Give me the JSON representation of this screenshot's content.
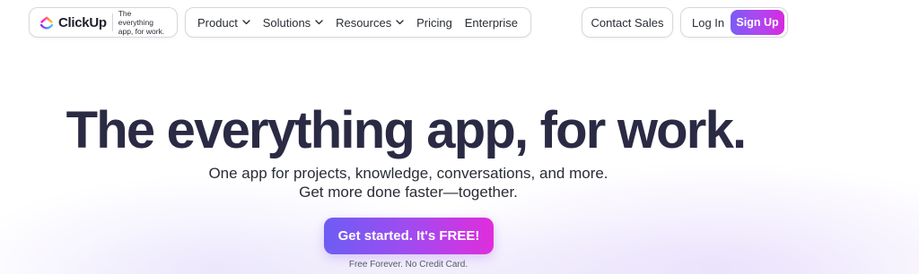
{
  "header": {
    "brand": {
      "name": "ClickUp",
      "tagline_line1": "The everything",
      "tagline_line2": "app, for work."
    },
    "menu": [
      {
        "label": "Product",
        "has_dropdown": true
      },
      {
        "label": "Solutions",
        "has_dropdown": true
      },
      {
        "label": "Resources",
        "has_dropdown": true
      },
      {
        "label": "Pricing",
        "has_dropdown": false
      },
      {
        "label": "Enterprise",
        "has_dropdown": false
      }
    ],
    "contact_sales": "Contact Sales",
    "login": "Log In",
    "signup": "Sign Up"
  },
  "hero": {
    "title": "The everything app, for work.",
    "subtitle_line1": "One app for projects, knowledge, conversations, and more.",
    "subtitle_line2": "Get more done faster—together.",
    "cta": "Get started. It's FREE!",
    "cta_note": "Free Forever. No Credit Card."
  },
  "icons": {
    "logo": "clickup-logo-icon",
    "dropdown": "chevron-down-icon"
  },
  "colors": {
    "accent_start": "#7b5cf5",
    "accent_mid": "#b145ef",
    "accent_end": "#d62ae0",
    "title": "#2b2a44",
    "text": "#292d34"
  }
}
